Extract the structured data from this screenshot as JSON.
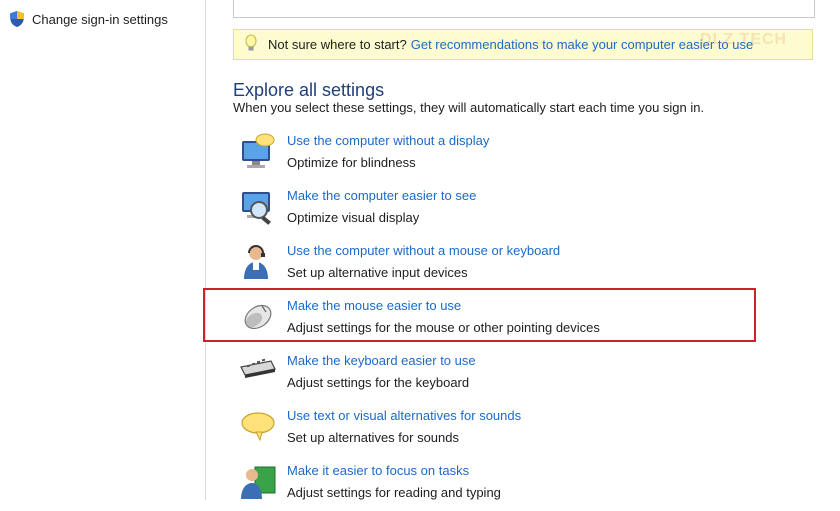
{
  "sidebar": {
    "link_label": "Change sign-in settings",
    "link_icon": "uac-shield-icon"
  },
  "tip": {
    "text": "Not sure where to start?",
    "link": "Get recommendations to make your computer easier to use",
    "icon": "lightbulb-icon"
  },
  "watermark": "DLZ TECH",
  "explore": {
    "title": "Explore all settings",
    "description": "When you select these settings, they will automatically start each time you sign in."
  },
  "items": [
    {
      "title": "Use the computer without a display",
      "subtitle": "Optimize for blindness",
      "icon": "monitor-speech-icon"
    },
    {
      "title": "Make the computer easier to see",
      "subtitle": "Optimize visual display",
      "icon": "monitor-magnifier-icon"
    },
    {
      "title": "Use the computer without a mouse or keyboard",
      "subtitle": "Set up alternative input devices",
      "icon": "person-headset-icon"
    },
    {
      "title": "Make the mouse easier to use",
      "subtitle": "Adjust settings for the mouse or other pointing devices",
      "icon": "mouse-icon"
    },
    {
      "title": "Make the keyboard easier to use",
      "subtitle": "Adjust settings for the keyboard",
      "icon": "keyboard-icon"
    },
    {
      "title": "Use text or visual alternatives for sounds",
      "subtitle": "Set up alternatives for sounds",
      "icon": "speech-bubble-icon"
    },
    {
      "title": "Make it easier to focus on tasks",
      "subtitle": "Adjust settings for reading and typing",
      "icon": "person-book-icon"
    }
  ],
  "colors": {
    "link": "#1b6ac9",
    "title": "#1f3f7a",
    "highlight_border": "#c4262c",
    "tip_background": "#fdfbd0"
  }
}
